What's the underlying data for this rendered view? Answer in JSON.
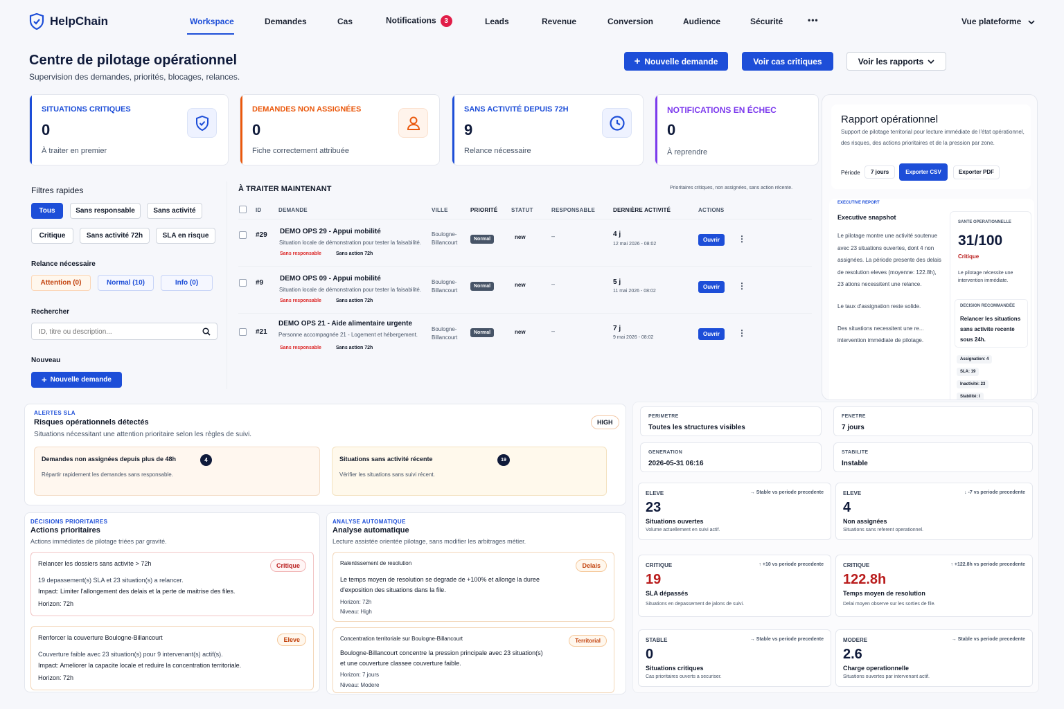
{
  "app": {
    "name": "HelpChain"
  },
  "nav": {
    "items": [
      "Workspace",
      "Demandes",
      "Cas",
      "Notifications",
      "Leads",
      "Revenue",
      "Conversion",
      "Audience",
      "Sécurité"
    ],
    "notifications_count": "3",
    "more": "•••",
    "platform_view": "Vue plateforme"
  },
  "header": {
    "title": "Centre de pilotage opérationnel",
    "subtitle": "Supervision des demandes, priorités, blocages, relances.",
    "new_request": "Nouvelle demande",
    "critical_cases": "Voir cas critiques",
    "reports": "Voir les rapports"
  },
  "stats": [
    {
      "title": "SITUATIONS CRITIQUES",
      "value": "0",
      "desc": "À traiter en premier",
      "color": "#1d4ed8",
      "icon": "shield-icon"
    },
    {
      "title": "DEMANDES NON ASSIGNÉES",
      "value": "0",
      "desc": "Fiche correctement attribuée",
      "color": "#ea580c",
      "icon": "user-icon"
    },
    {
      "title": "SANS ACTIVITÉ DEPUIS 72H",
      "value": "9",
      "desc": "Relance nécessaire",
      "color": "#1d4ed8",
      "icon": "clock-icon"
    },
    {
      "title": "NOTIFICATIONS EN ÉCHEC",
      "value": "0",
      "desc": "À reprendre",
      "color": "#7c3aed",
      "icon": ""
    }
  ],
  "sidebar": {
    "quick_filters_title": "Filtres rapides",
    "filters": [
      "Tous",
      "Sans responsable",
      "Sans activité",
      "Critique",
      "Sans activité 72h",
      "SLA en risque"
    ],
    "followup_title": "Relance nécessaire",
    "followups": [
      "Attention (0)",
      "Normal (10)",
      "Info (0)"
    ],
    "search_title": "Rechercher",
    "search_placeholder": "ID, titre ou description...",
    "new_title": "Nouveau",
    "new_button": "Nouvelle demande"
  },
  "table": {
    "title": "À TRAITER MAINTENANT",
    "hint": "Prioritaires critiques, non assignées, sans action récente.",
    "columns": [
      "ID",
      "DEMANDE",
      "VILLE",
      "PRIORITÉ",
      "STATUT",
      "RESPONSABLE",
      "DERNIÈRE ACTIVITÉ",
      "ACTIONS"
    ],
    "open_label": "Ouvrir",
    "rows": [
      {
        "id": "#29",
        "title": "DEMO OPS 29 - Appui mobilité",
        "desc": "Situation locale de démonstration pour tester la faisabilité.",
        "tag1": "Sans responsable",
        "tag2": "Sans action 72h",
        "city": "Boulogne-Billancourt",
        "priority": "Normal",
        "status": "new",
        "owner": "–",
        "age": "4 j",
        "date": "12 mai 2026 - 08:02"
      },
      {
        "id": "#9",
        "title": "DEMO OPS 09 - Appui mobilité",
        "desc": "Situation locale de démonstration pour tester la faisabilité.",
        "tag1": "Sans responsable",
        "tag2": "Sans action 72h",
        "city": "Boulogne-Billancourt",
        "priority": "Normal",
        "status": "new",
        "owner": "–",
        "age": "5 j",
        "date": "11 mai 2026 - 08:02"
      },
      {
        "id": "#21",
        "title": "DEMO OPS 21 - Aide alimentaire urgente",
        "desc": "Personne accompagnée 21 - Logement et hébergement.",
        "tag1": "Sans responsable",
        "tag2": "Sans action 72h",
        "city": "Boulogne-Billancourt",
        "priority": "Normal",
        "status": "new",
        "owner": "–",
        "age": "7 j",
        "date": "9 mai 2026 - 08:02"
      }
    ]
  },
  "report": {
    "title": "Rapport opérationnel",
    "desc": "Support de pilotage territorial pour lecture immédiate de l'état opérationnel, des risques, des actions prioritaires et de la pression par zone.",
    "period_label": "Période",
    "period_value": "7 jours",
    "export_csv": "Exporter CSV",
    "export_pdf": "Exporter PDF",
    "exec_label": "EXECUTIVE REPORT",
    "exec_title": "Executive snapshot",
    "exec_text1": "Le pilotage montre une activité soutenue avec 23 situations ouvertes, dont 4 non assignées. La période presente des delais de resolution eleves (moyenne: 122.8h), 23 ations necessitent une relance.",
    "exec_text2": "Le taux d'assignation reste solide.",
    "exec_text3": "Des situations necessitent une re... intervention immédiate de pilotage.",
    "health_label": "SANTE OPERATIONNELLE",
    "health_value": "31/100",
    "health_status": "Critique",
    "health_desc": "Le pilotage nécessite une intervention immédiate.",
    "decision_label": "DECISION RECOMMANDÉE",
    "decision_text": "Relancer les situations sans activite recente sous 24h.",
    "chips": [
      "Assignation: 4",
      "SLA: 19",
      "Inactivité: 23",
      "Stabilité: I"
    ]
  },
  "alerts": {
    "label": "ALERTES SLA",
    "title": "Risques opérationnels détectés",
    "desc": "Situations nécessitant une attention prioritaire selon les règles de suivi.",
    "level": "HIGH",
    "items": [
      {
        "title": "Demandes non assignées depuis plus de 48h",
        "count": "4",
        "desc": "Répartir rapidement les demandes sans responsable."
      },
      {
        "title": "Situations sans activité récente",
        "count": "19",
        "desc": "Vérifier les situations sans suivi récent."
      }
    ]
  },
  "context": [
    {
      "label": "PERIMETRE",
      "value": "Toutes les structures visibles"
    },
    {
      "label": "FENETRE",
      "value": "7 jours"
    },
    {
      "label": "GENERATION",
      "value": "2026-05-31 06:16"
    },
    {
      "label": "STABILITE",
      "value": "Instable"
    }
  ],
  "metrics": [
    {
      "level": "ELEVE",
      "trend": "→ Stable vs periode precedente",
      "value": "23",
      "name": "Situations ouvertes",
      "desc": "Volume actuellement en suivi actif.",
      "red": false
    },
    {
      "level": "ELEVE",
      "trend": "↓ -7 vs periode precedente",
      "value": "4",
      "name": "Non assignées",
      "desc": "Situations sans referent operationnel.",
      "red": false
    },
    {
      "level": "CRITIQUE",
      "trend": "↑ +10 vs periode precedente",
      "value": "19",
      "name": "SLA dépassés",
      "desc": "Situations en depassement de jalons de suivi.",
      "red": true
    },
    {
      "level": "CRITIQUE",
      "trend": "↑ +122.8h vs periode precedente",
      "value": "122.8h",
      "name": "Temps moyen de resolution",
      "desc": "Delai moyen observe sur les sorties de file.",
      "red": true
    },
    {
      "level": "STABLE",
      "trend": "→ Stable vs periode precedente",
      "value": "0",
      "name": "Situations critiques",
      "desc": "Cas prioritaires ouverts a securiser.",
      "red": false
    },
    {
      "level": "MODERE",
      "trend": "→ Stable vs periode precedente",
      "value": "2.6",
      "name": "Charge operationnelle",
      "desc": "Situations ouvertes par intervenant actif.",
      "red": false
    }
  ],
  "decisions": {
    "label": "DÉCISIONS PRIORITAIRES",
    "title": "Actions prioritaires",
    "desc": "Actions immédiates de pilotage triées par gravité.",
    "items": [
      {
        "title": "Relancer les dossiers sans activite > 72h",
        "badge": "Critique",
        "line1": "19 depassement(s) SLA et 23 situation(s) a relancer.",
        "line2": "Impact: Limiter l'allongement des delais et la perte de maitrise des files.",
        "line3": "Horizon: 72h"
      },
      {
        "title": "Renforcer la couverture Boulogne-Billancourt",
        "badge": "Eleve",
        "line1": "Couverture faible avec 23 situation(s) pour 9 intervenant(s) actif(s).",
        "line2": "Impact: Ameliorer la capacite locale et reduire la concentration territoriale.",
        "line3": "Horizon: 72h"
      }
    ]
  },
  "analysis": {
    "label": "ANALYSE AUTOMATIQUE",
    "title": "Analyse automatique",
    "desc": "Lecture assistée orientée pilotage, sans modifier les arbitrages métier.",
    "items": [
      {
        "title": "Ralentissement de resolution",
        "badge": "Delais",
        "line1": "Le temps moyen de resolution se degrade de +100% et allonge la duree",
        "line2": "d'exposition des situations dans la file.",
        "line3": "Horizon: 72h",
        "line4": "Niveau: High"
      },
      {
        "title": "Concentration territoriale sur Boulogne-Billancourt",
        "badge": "Territorial",
        "line1": "Boulogne-Billancourt concentre la pression principale avec 23 situation(s)",
        "line2": "et une couverture classee couverture faible.",
        "line3": "Horizon: 7 jours",
        "line4": "Niveau: Modere"
      }
    ]
  }
}
